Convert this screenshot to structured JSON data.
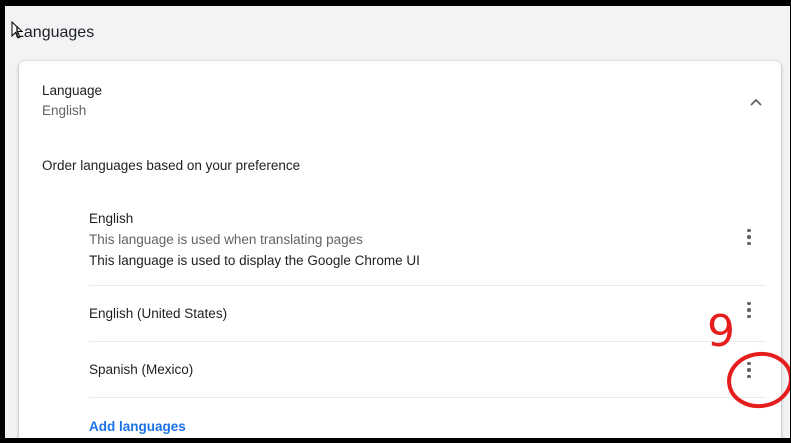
{
  "section": {
    "title": "Languages"
  },
  "language_card": {
    "label": "Language",
    "value": "English",
    "order_text": "Order languages based on your preference",
    "languages": [
      {
        "name": "English",
        "note_translate": "This language is used when translating pages",
        "note_ui": "This language is used to display the Google Chrome UI"
      },
      {
        "name": "English (United States)"
      },
      {
        "name": "Spanish (Mexico)"
      }
    ],
    "add_label": "Add languages"
  },
  "annotation": {
    "step": "9",
    "color": "#e51d1d"
  },
  "colors": {
    "link": "#1a73e8",
    "text": "#202124",
    "secondary": "#5f6368"
  },
  "icons": {
    "collapse": "chevron-up-icon",
    "more": "more-vert-icon",
    "cursor": "mouse-pointer-icon"
  }
}
